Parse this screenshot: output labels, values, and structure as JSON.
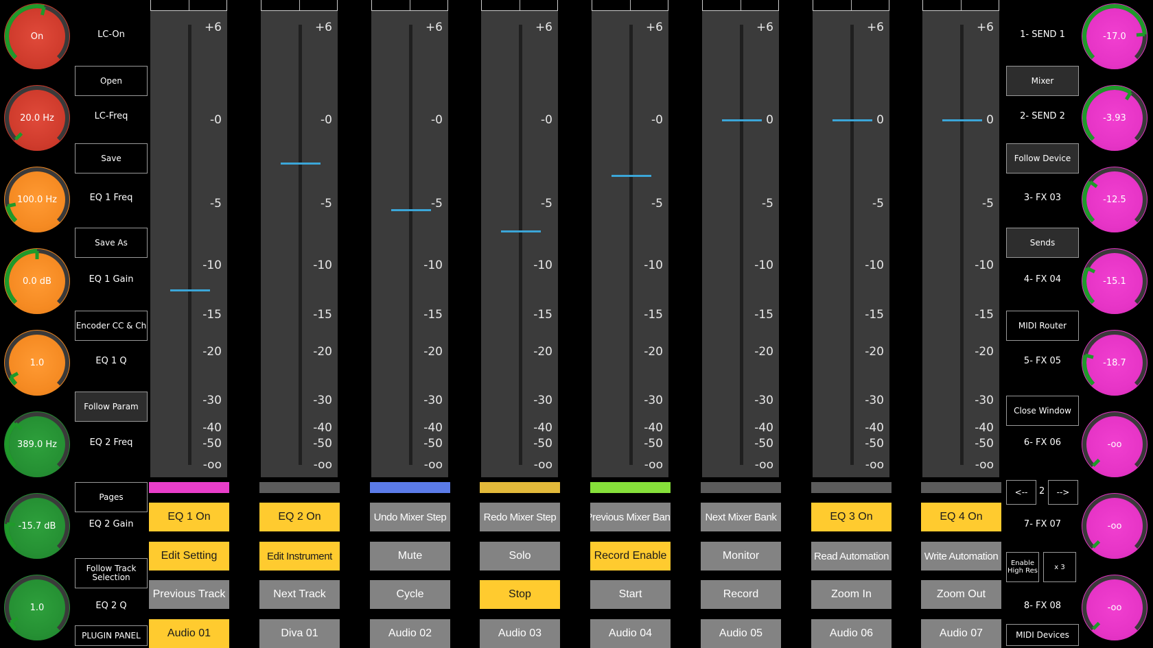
{
  "left_knobs": [
    {
      "value": "On",
      "label": "LC-On",
      "color": "red",
      "level": 0.55
    },
    {
      "value": "20.0 Hz",
      "label": "LC-Freq",
      "color": "red",
      "level": 0.0
    },
    {
      "value": "100.0 Hz",
      "label": "EQ 1 Freq",
      "color": "orange",
      "level": 0.12
    },
    {
      "value": "0.0 dB",
      "label": "EQ 1 Gain",
      "color": "orange",
      "level": 0.5
    },
    {
      "value": "1.0",
      "label": "EQ 1 Q",
      "color": "orange",
      "level": 0.06
    },
    {
      "value": "389.0 Hz",
      "label": "EQ 2 Freq",
      "color": "green",
      "level": 0.33
    },
    {
      "value": "-15.7 dB",
      "label": "EQ 2 Gain",
      "color": "green",
      "level": 0.18
    },
    {
      "value": "1.0",
      "label": "EQ 2 Q",
      "color": "green",
      "level": 0.06
    }
  ],
  "left_buttons": [
    "Open",
    "Save",
    "Save As",
    "Encoder CC & Ch",
    "Follow Param",
    "Pages",
    "Follow Track Selection",
    "PLUGIN PANEL"
  ],
  "fader_scale": [
    "+6",
    "-0",
    "-5",
    "-10",
    "-15",
    "-20",
    "-30",
    "-40",
    "-50",
    "-oo"
  ],
  "channels": [
    {
      "level_db": -12.5,
      "strip_color": "#e83ec9",
      "row1": "EQ 1 On",
      "row1_style": "y",
      "row2": "Edit Setting",
      "row2_style": "y",
      "row3": "Previous Track",
      "row3_style": "g",
      "name": "Audio 01",
      "name_style": "y",
      "zero_label": "-0"
    },
    {
      "level_db": -2.6,
      "strip_color": "#5c5c5c",
      "row1": "EQ 2 On",
      "row1_style": "y",
      "row2": "Edit Instrument",
      "row2_style": "y",
      "row3": "Next Track",
      "row3_style": "g",
      "name": "Diva 01",
      "name_style": "g",
      "zero_label": "-0"
    },
    {
      "level_db": -5.5,
      "strip_color": "#5b7be8",
      "row1": "Undo Mixer Step",
      "row1_style": "g",
      "row2": "Mute",
      "row2_style": "g",
      "row3": "Cycle",
      "row3_style": "g",
      "name": "Audio 02",
      "name_style": "g",
      "zero_label": "-0"
    },
    {
      "level_db": -7.2,
      "strip_color": "#e2b93a",
      "row1": "Redo Mixer Step",
      "row1_style": "g",
      "row2": "Solo",
      "row2_style": "g",
      "row3": "Stop",
      "row3_style": "y",
      "name": "Audio 03",
      "name_style": "g",
      "zero_label": "-0"
    },
    {
      "level_db": -3.3,
      "strip_color": "#86e03a",
      "row1": "Previous Mixer Bank",
      "row1_style": "g",
      "row2": "Record Enable",
      "row2_style": "y",
      "row3": "Start",
      "row3_style": "g",
      "name": "Audio 04",
      "name_style": "g",
      "zero_label": "-0"
    },
    {
      "level_db": 0,
      "strip_color": "#5c5c5c",
      "row1": "Next Mixer Bank",
      "row1_style": "g",
      "row2": "Monitor",
      "row2_style": "g",
      "row3": "Record",
      "row3_style": "g",
      "name": "Audio 05",
      "name_style": "g",
      "zero_label": "0"
    },
    {
      "level_db": 0,
      "strip_color": "#5c5c5c",
      "row1": "EQ 3 On",
      "row1_style": "y",
      "row2": "Read Automation",
      "row2_style": "g",
      "row3": "Zoom In",
      "row3_style": "g",
      "name": "Audio 06",
      "name_style": "g",
      "zero_label": "0"
    },
    {
      "level_db": 0,
      "strip_color": "#5c5c5c",
      "row1": "EQ 4 On",
      "row1_style": "y",
      "row2": "Write Automation",
      "row2_style": "g",
      "row3": "Zoom Out",
      "row3_style": "g",
      "name": "Audio 07",
      "name_style": "g",
      "zero_label": "0"
    }
  ],
  "right_knobs": [
    {
      "value": "-17.0",
      "label": "1- SEND 1",
      "level": 0.82
    },
    {
      "value": "-3.93",
      "label": "2- SEND 2",
      "level": 0.62
    },
    {
      "value": "-12.5",
      "label": "3- FX 03",
      "level": 0.3
    },
    {
      "value": "-15.1",
      "label": "4- FX 04",
      "level": 0.26
    },
    {
      "value": "-18.7",
      "label": "5- FX 05",
      "level": 0.22
    },
    {
      "value": "-oo",
      "label": "6- FX 06",
      "level": 0.0
    },
    {
      "value": "-oo",
      "label": "7- FX 07",
      "level": 0.0
    },
    {
      "value": "-oo",
      "label": "8- FX 08",
      "level": 0.0
    }
  ],
  "right_buttons": [
    "Mixer",
    "Follow Device",
    "Sends",
    "MIDI Router",
    "Close Window"
  ],
  "pager": {
    "prev": "<--",
    "page": "2",
    "next": "-->"
  },
  "enable_high_res": "Enable High Res",
  "x3": "x 3",
  "midi_devices": "MIDI Devices",
  "colors": {
    "fader_handle": "#3ba6d8",
    "yellow_button": "#ffcb2f",
    "gray_button": "#838383",
    "knob_red": "#cf3b2c",
    "knob_orange": "#f58a22",
    "knob_green": "#259033",
    "knob_pink": "#e634c6"
  }
}
